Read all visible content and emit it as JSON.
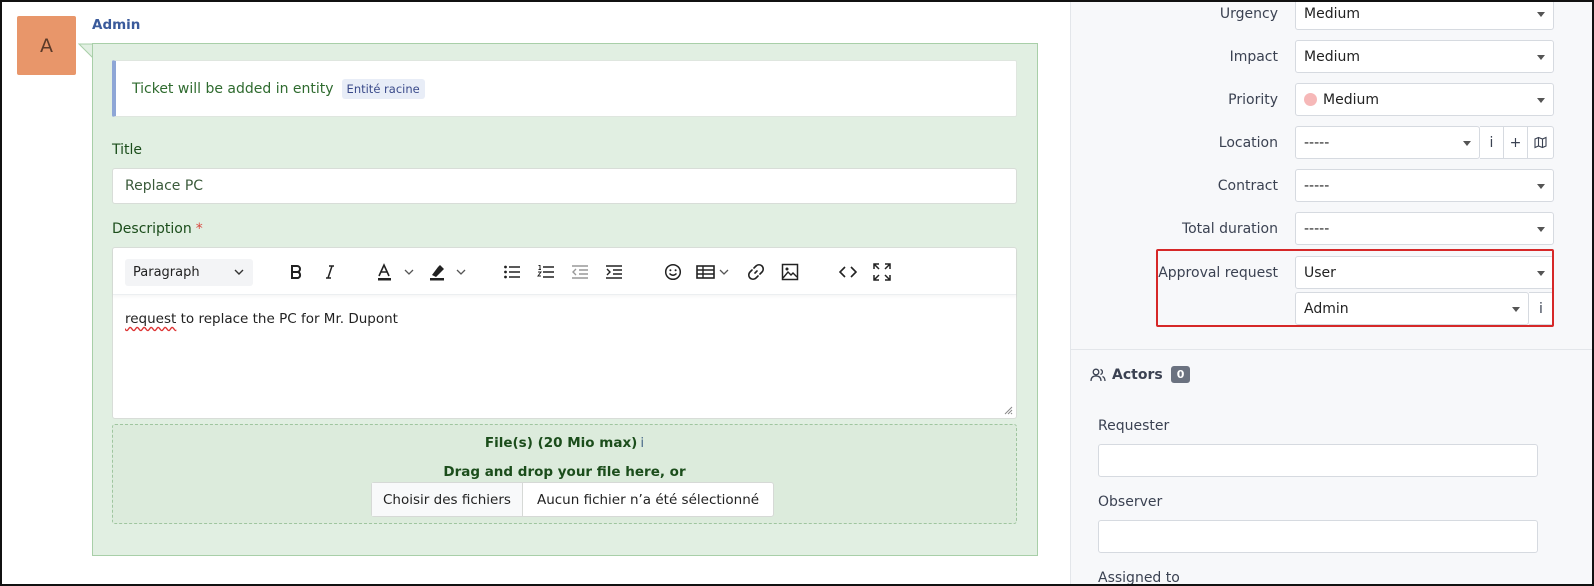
{
  "author": {
    "initial": "A",
    "name": "Admin"
  },
  "notice": {
    "text": "Ticket will be added in entity",
    "entity": "Entité racine"
  },
  "title_field": {
    "label": "Title",
    "value": "Replace PC"
  },
  "description": {
    "label": "Description",
    "required_mark": "*",
    "paragraph_style": "Paragraph",
    "content_misspelled": "request",
    "content_rest": " to replace the PC for Mr. Dupont"
  },
  "files": {
    "title": "File(s) (20 Mio max)",
    "info_glyph": "i",
    "drag_text": "Drag and drop your file here, or",
    "choose_button": "Choisir des fichiers",
    "status": "Aucun fichier n’a été sélectionné"
  },
  "fields": {
    "urgency": {
      "label": "Urgency",
      "value": "Medium"
    },
    "impact": {
      "label": "Impact",
      "value": "Medium"
    },
    "priority": {
      "label": "Priority",
      "value": "Medium",
      "dot_color": "#f6b8b8"
    },
    "location": {
      "label": "Location",
      "value": "-----"
    },
    "contract": {
      "label": "Contract",
      "value": "-----"
    },
    "total_duration": {
      "label": "Total duration",
      "value": "-----"
    },
    "approval_request": {
      "label": "Approval request",
      "type_value": "User",
      "user_value": "Admin"
    }
  },
  "actors": {
    "title": "Actors",
    "count": "0",
    "requester_label": "Requester",
    "observer_label": "Observer",
    "assigned_label_partial": "Assigned to"
  },
  "icons": {
    "info": "i",
    "plus": "+"
  },
  "colors": {
    "avatar_bg": "#e8966a",
    "bubble_bg": "#e1efe2",
    "highlight": "#d62828",
    "author": "#3a5a9b"
  }
}
